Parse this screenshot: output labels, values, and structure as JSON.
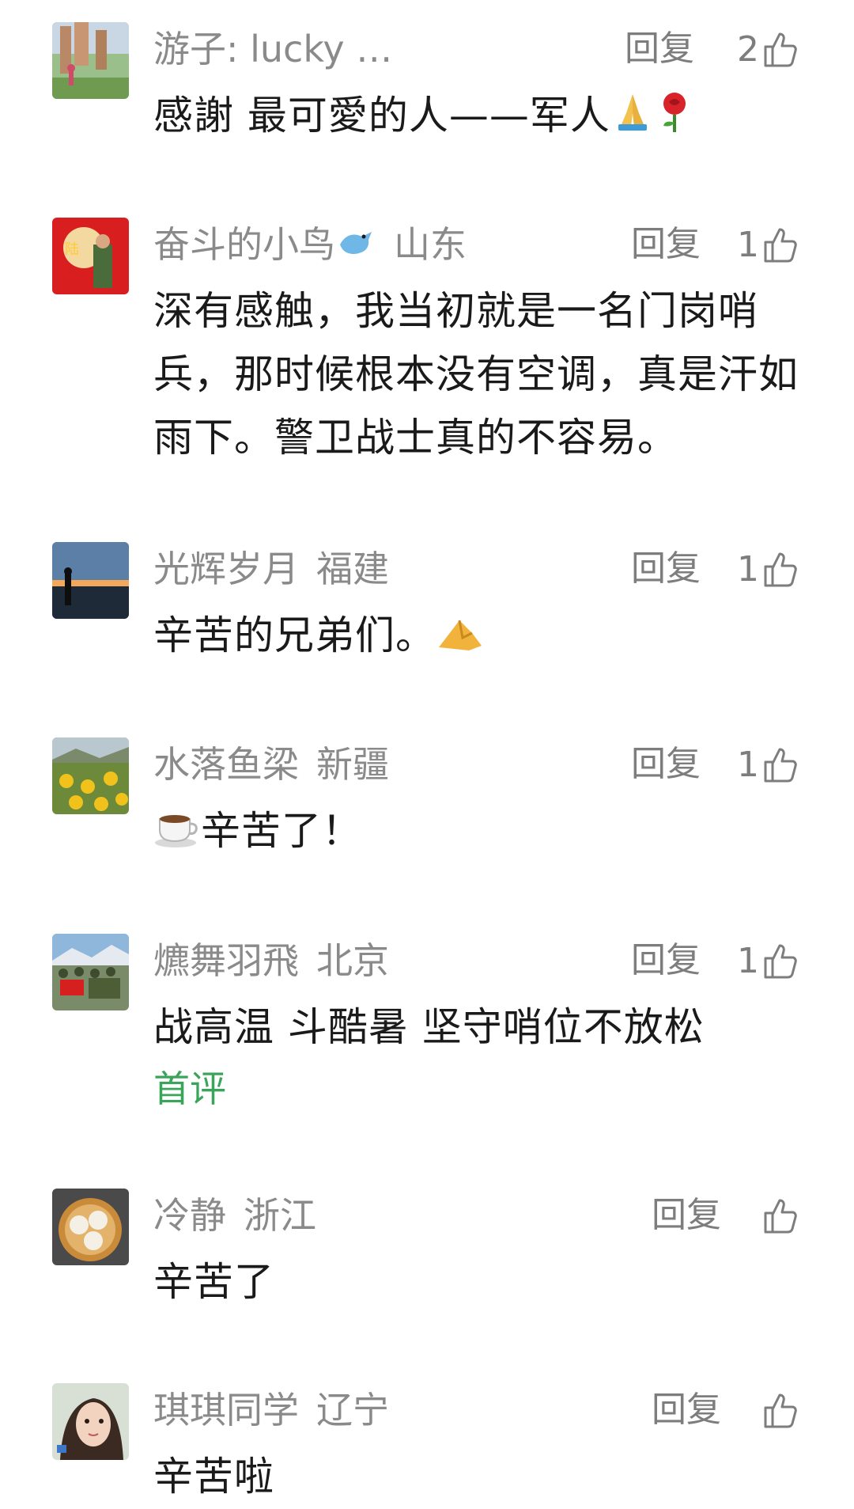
{
  "comments": [
    {
      "name": "游子: lucky …",
      "location": "",
      "reply": "回复",
      "likes": "2",
      "text": "感謝 最可愛的人——军人",
      "emoji": [
        "praying-hands-icon",
        "rose-icon"
      ],
      "tag": ""
    },
    {
      "name": "奋斗的小鸟",
      "location": "山东",
      "reply": "回复",
      "likes": "1",
      "text": "深有感触，我当初就是一名门岗哨兵，那时候根本没有空调，真是汗如雨下。警卫战士真的不容易。",
      "emoji": [
        "bird-icon"
      ],
      "tag": ""
    },
    {
      "name": "光辉岁月",
      "location": "福建",
      "reply": "回复",
      "likes": "1",
      "text": "辛苦的兄弟们。",
      "emoji": [
        "ok-hand-icon"
      ],
      "tag": ""
    },
    {
      "name": "水落鱼梁",
      "location": "新疆",
      "reply": "回复",
      "likes": "1",
      "text": "辛苦了！",
      "emoji": [
        "coffee-icon"
      ],
      "tag": ""
    },
    {
      "name": "爊舞羽飛",
      "location": "北京",
      "reply": "回复",
      "likes": "1",
      "text": "战高温 斗酷暑 坚守哨位不放松",
      "emoji": [],
      "tag": "首评"
    },
    {
      "name": "冷静",
      "location": "浙江",
      "reply": "回复",
      "likes": "",
      "text": "辛苦了",
      "emoji": [],
      "tag": ""
    },
    {
      "name": "琪琪同学",
      "location": "辽宁",
      "reply": "回复",
      "likes": "",
      "text": "辛苦啦",
      "emoji": [],
      "tag": ""
    }
  ],
  "colors": {
    "name": "#8a8a8a",
    "text": "#1a1a1a",
    "tag": "#3aa55a",
    "background": "#ffffff"
  }
}
